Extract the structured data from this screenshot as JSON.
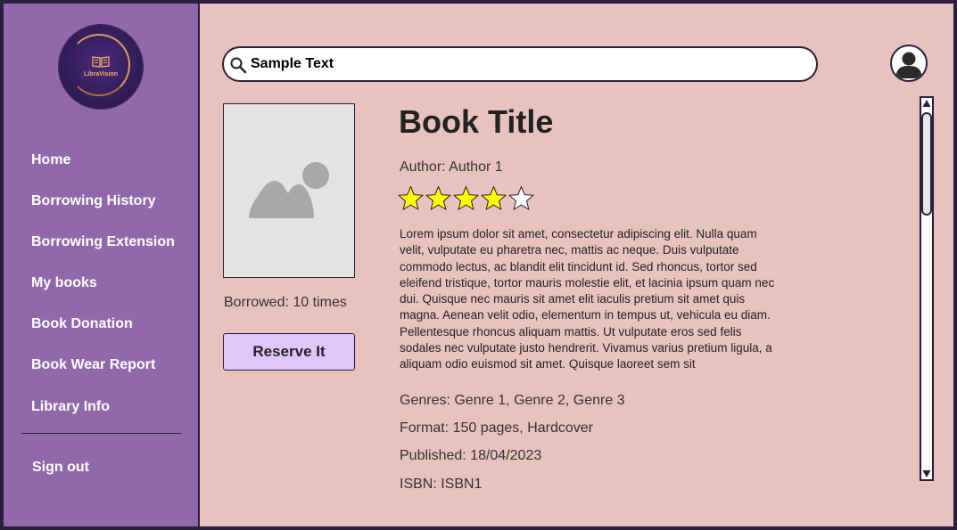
{
  "app": {
    "logo_text": "LibraVision"
  },
  "sidebar": {
    "items": [
      {
        "label": "Home"
      },
      {
        "label": "Borrowing History"
      },
      {
        "label": "Borrowing Extension"
      },
      {
        "label": "My books"
      },
      {
        "label": "Book Donation"
      },
      {
        "label": "Book Wear Report"
      },
      {
        "label": "Library Info"
      }
    ],
    "signout_label": "Sign out"
  },
  "search": {
    "value": "Sample Text"
  },
  "book": {
    "title": "Book Title",
    "author_line": "Author: Author 1",
    "rating": 4,
    "rating_max": 5,
    "description": "Lorem ipsum dolor sit amet, consectetur adipiscing elit. Nulla quam velit, vulputate eu pharetra nec, mattis ac neque. Duis vulputate commodo lectus, ac blandit elit tincidunt id. Sed rhoncus, tortor sed eleifend tristique, tortor mauris molestie elit, et lacinia ipsum quam nec dui. Quisque nec mauris sit amet elit iaculis pretium sit amet quis magna. Aenean velit odio, elementum in tempus ut, vehicula eu diam. Pellentesque rhoncus aliquam mattis. Ut vulputate eros sed felis sodales nec vulputate justo hendrerit. Vivamus varius pretium ligula, a aliquam odio euismod sit amet. Quisque laoreet sem sit",
    "genres_line": "Genres: Genre 1, Genre 2, Genre 3",
    "format_line": "Format: 150 pages, Hardcover",
    "published_line": "Published: 18/04/2023",
    "isbn_line": "ISBN: ISBN1",
    "borrowed_line": "Borrowed: 10 times",
    "reserve_label": "Reserve It"
  },
  "colors": {
    "sidebar_bg": "#9169ab",
    "content_bg": "#e8c2bf",
    "border": "#2a1f3f",
    "button_bg": "#e0c6fb",
    "star_fill": "#ffff00",
    "star_empty": "#ffffff"
  },
  "icons": {
    "search": "search-icon",
    "avatar": "user-avatar-icon",
    "cover": "image-placeholder-icon",
    "logo": "book-logo-icon",
    "scroll_up": "triangle-up-icon",
    "scroll_down": "triangle-down-icon"
  }
}
